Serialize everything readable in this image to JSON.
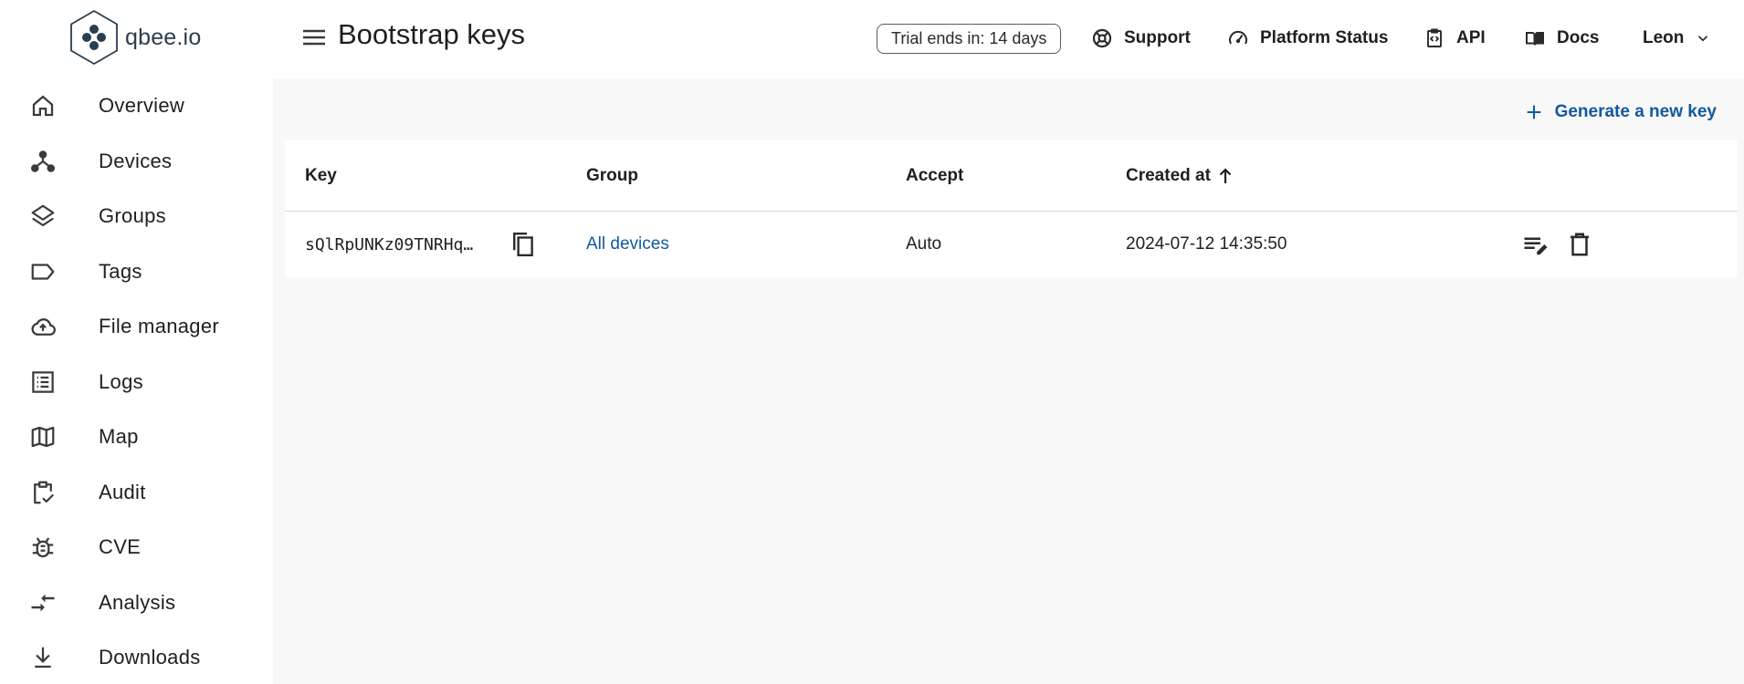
{
  "app": {
    "logo_text": "qbee.io"
  },
  "sidebar": {
    "items": [
      {
        "label": "Overview",
        "icon": "home-icon"
      },
      {
        "label": "Devices",
        "icon": "devices-icon"
      },
      {
        "label": "Groups",
        "icon": "layers-icon"
      },
      {
        "label": "Tags",
        "icon": "tag-icon"
      },
      {
        "label": "File manager",
        "icon": "cloud-upload-icon"
      },
      {
        "label": "Logs",
        "icon": "list-icon"
      },
      {
        "label": "Map",
        "icon": "map-icon"
      },
      {
        "label": "Audit",
        "icon": "clipboard-check-icon"
      },
      {
        "label": "CVE",
        "icon": "bug-icon"
      },
      {
        "label": "Analysis",
        "icon": "compare-arrows-icon"
      },
      {
        "label": "Downloads",
        "icon": "download-icon"
      }
    ]
  },
  "header": {
    "title": "Bootstrap keys",
    "trial": "Trial ends in: 14 days",
    "links": {
      "support": "Support",
      "status": "Platform Status",
      "api": "API",
      "docs": "Docs",
      "user": "Leon"
    }
  },
  "main": {
    "generate_label": "Generate a new key",
    "table": {
      "columns": [
        "Key",
        "Group",
        "Accept",
        "Created at"
      ],
      "rows": [
        {
          "key": "sQlRpUNKz09TNRHq…",
          "group": "All devices",
          "accept": "Auto",
          "created_at": "2024-07-12 14:35:50"
        }
      ]
    }
  },
  "colors": {
    "accent": "#12599f",
    "main_bg": "#f8f8f8",
    "logo": "#2b3e50"
  }
}
